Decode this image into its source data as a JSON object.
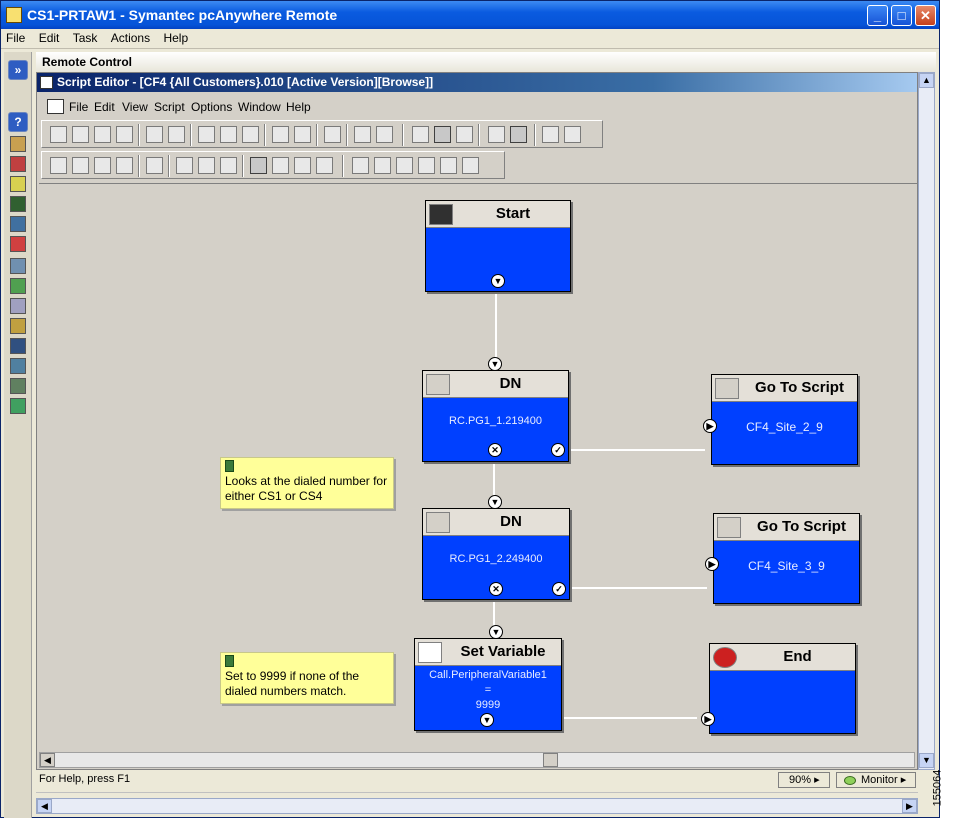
{
  "window": {
    "title": "CS1-PRTAW1 - Symantec pcAnywhere Remote",
    "menu": [
      "File",
      "Edit",
      "Task",
      "Actions",
      "Help"
    ]
  },
  "remote_banner": "Remote Control",
  "script_editor": {
    "title": "Script Editor - [CF4 {All Customers}.010 [Active Version][Browse]]",
    "menu": [
      "File",
      "Edit",
      "View",
      "Script",
      "Options",
      "Window",
      "Help"
    ]
  },
  "nodes": {
    "start": {
      "title": "Start"
    },
    "dn1": {
      "title": "DN",
      "value": "RC.PG1_1.219400"
    },
    "dn2": {
      "title": "DN",
      "value": "RC.PG1_2.249400"
    },
    "goto1": {
      "title": "Go To Script",
      "value": "CF4_Site_2_9"
    },
    "goto2": {
      "title": "Go To Script",
      "value": "CF4_Site_3_9"
    },
    "setvar": {
      "title": "Set Variable",
      "line1": "Call.PeripheralVariable1",
      "line2": "=",
      "line3": "9999"
    },
    "end": {
      "title": "End"
    }
  },
  "notes": {
    "note1": "Looks at the dialed number for either CS1 or CS4",
    "note2": "Set to 9999 if none of the dialed numbers match."
  },
  "status": {
    "help": "For Help, press F1",
    "zoom": "90%",
    "mode": "Monitor"
  },
  "figure_id": "155064"
}
